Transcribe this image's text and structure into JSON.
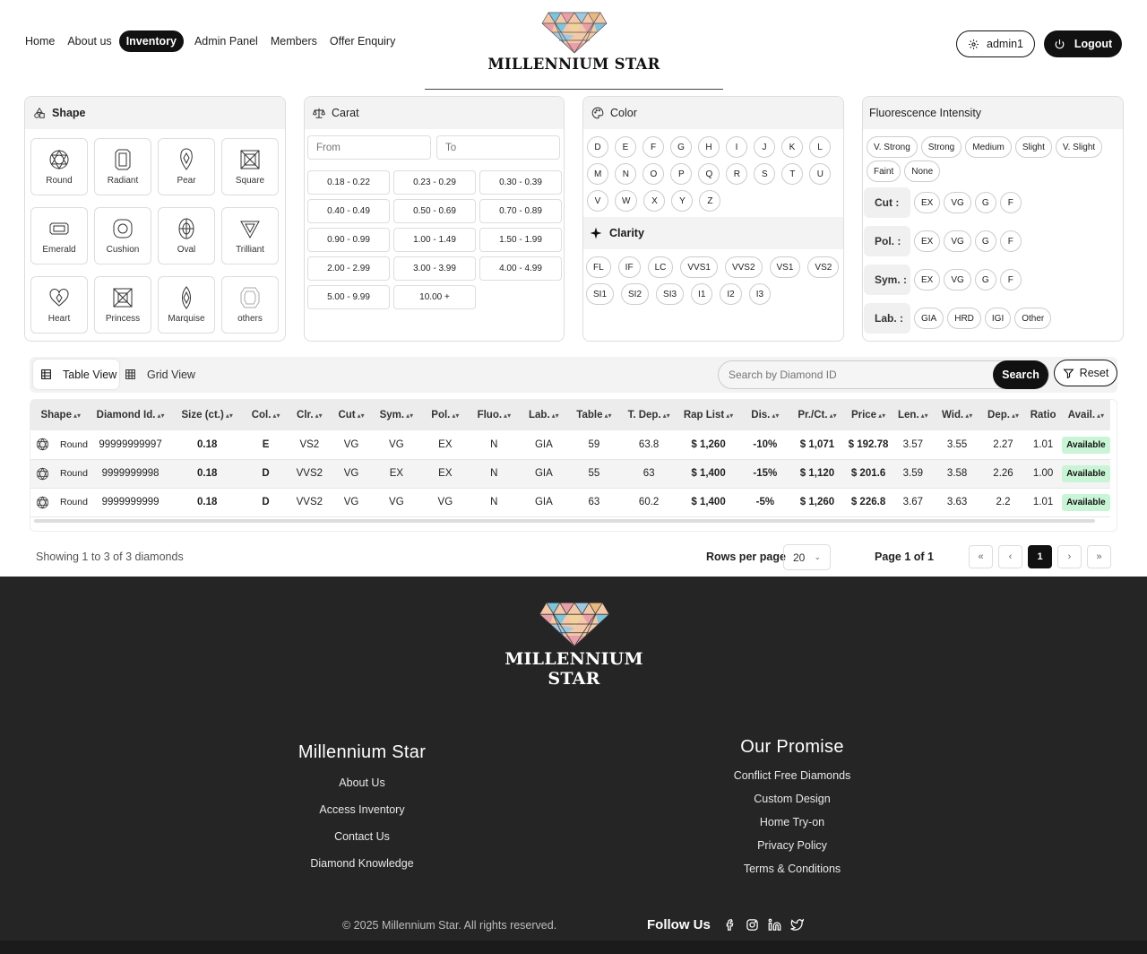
{
  "nav": {
    "items": [
      {
        "label": "Home",
        "active": false
      },
      {
        "label": "About us",
        "active": false
      },
      {
        "label": "Inventory",
        "active": true
      },
      {
        "label": "Admin Panel",
        "active": false
      },
      {
        "label": "Members",
        "active": false
      },
      {
        "label": "Offer Enquiry",
        "active": false
      }
    ]
  },
  "brand": {
    "name": "MILLENNIUM STAR"
  },
  "user": {
    "name": "admin1",
    "logout_label": "Logout"
  },
  "filters": {
    "shape": {
      "title": "Shape",
      "items": [
        "Round",
        "Radiant",
        "Pear",
        "Square",
        "Emerald",
        "Cushion",
        "Oval",
        "Trilliant",
        "Heart",
        "Princess",
        "Marquise",
        "others"
      ]
    },
    "carat": {
      "title": "Carat",
      "from_placeholder": "From",
      "to_placeholder": "To",
      "ranges": [
        "0.18 - 0.22",
        "0.23 - 0.29",
        "0.30 - 0.39",
        "0.40 - 0.49",
        "0.50 - 0.69",
        "0.70 - 0.89",
        "0.90 - 0.99",
        "1.00 - 1.49",
        "1.50 - 1.99",
        "2.00 - 2.99",
        "3.00 - 3.99",
        "4.00 - 4.99",
        "5.00 - 9.99",
        "10.00 +"
      ]
    },
    "color": {
      "title": "Color",
      "items": [
        "D",
        "E",
        "F",
        "G",
        "H",
        "I",
        "J",
        "K",
        "L",
        "M",
        "N",
        "O",
        "P",
        "Q",
        "R",
        "S",
        "T",
        "U",
        "V",
        "W",
        "X",
        "Y",
        "Z"
      ]
    },
    "clarity": {
      "title": "Clarity",
      "items": [
        "FL",
        "IF",
        "LC",
        "VVS1",
        "VVS2",
        "VS1",
        "VS2",
        "SI1",
        "SI2",
        "SI3",
        "I1",
        "I2",
        "I3"
      ]
    },
    "fluorescence": {
      "title": "Fluorescence Intensity",
      "items": [
        "V. Strong",
        "Strong",
        "Medium",
        "Slight",
        "V. Slight",
        "Faint",
        "None"
      ]
    },
    "cut": {
      "label": "Cut :",
      "items": [
        "EX",
        "VG",
        "G",
        "F"
      ]
    },
    "polish": {
      "label": "Pol. :",
      "items": [
        "EX",
        "VG",
        "G",
        "F"
      ]
    },
    "symmetry": {
      "label": "Sym. :",
      "items": [
        "EX",
        "VG",
        "G",
        "F"
      ]
    },
    "lab": {
      "label": "Lab. :",
      "items": [
        "GIA",
        "HRD",
        "IGI",
        "Other"
      ]
    }
  },
  "toolbar": {
    "table_view": "Table View",
    "grid_view": "Grid View",
    "search_placeholder": "Search by Diamond ID",
    "search_label": "Search",
    "reset_label": "Reset"
  },
  "table": {
    "columns": [
      "Shape",
      "Diamond Id.",
      "Size (ct.)",
      "Col.",
      "Clr.",
      "Cut",
      "Sym.",
      "Pol.",
      "Fluo.",
      "Lab.",
      "Table",
      "T. Dep.",
      "Rap List",
      "Dis.",
      "Pr./Ct.",
      "Price",
      "Len.",
      "Wid.",
      "Dep.",
      "Ratio",
      "Avail."
    ],
    "rows": [
      [
        "Round",
        "99999999997",
        "0.18",
        "E",
        "VS2",
        "VG",
        "VG",
        "EX",
        "N",
        "GIA",
        "59",
        "63.8",
        "$ 1,260",
        "-10%",
        "$ 1,071",
        "$ 192.78",
        "3.57",
        "3.55",
        "2.27",
        "1.01",
        "Available"
      ],
      [
        "Round",
        "9999999998",
        "0.18",
        "D",
        "VVS2",
        "VG",
        "EX",
        "EX",
        "N",
        "GIA",
        "55",
        "63",
        "$ 1,400",
        "-15%",
        "$ 1,120",
        "$ 201.6",
        "3.59",
        "3.58",
        "2.26",
        "1.00",
        "Available"
      ],
      [
        "Round",
        "9999999999",
        "0.18",
        "D",
        "VVS2",
        "VG",
        "VG",
        "VG",
        "N",
        "GIA",
        "63",
        "60.2",
        "$ 1,400",
        "-5%",
        "$ 1,260",
        "$ 226.8",
        "3.67",
        "3.63",
        "2.2",
        "1.01",
        "Available"
      ]
    ]
  },
  "pagination": {
    "showing": "Showing 1 to 3 of 3 diamonds",
    "rows_per_page_label": "Rows per page",
    "rows_per_page_value": "20",
    "page_of": "Page 1 of 1",
    "current_page": "1"
  },
  "footer": {
    "brand": "MILLENNIUM STAR",
    "col1": {
      "title": "Millennium Star",
      "links": [
        "About Us",
        "Access Inventory",
        "Contact Us",
        "Diamond Knowledge"
      ]
    },
    "col2": {
      "title": "Our Promise",
      "links": [
        "Conflict Free Diamonds",
        "Custom Design",
        "Home Try-on",
        "Privacy Policy",
        "Terms & Conditions"
      ]
    },
    "copyright": "© 2025 Millennium Star. All rights reserved.",
    "follow_label": "Follow Us",
    "social_icons": [
      "facebook-icon",
      "instagram-icon",
      "linkedin-icon",
      "twitter-icon"
    ]
  },
  "colors": {
    "accent": "#111111",
    "footer_bg": "#252525",
    "available_badge": "#c9f5d6"
  }
}
